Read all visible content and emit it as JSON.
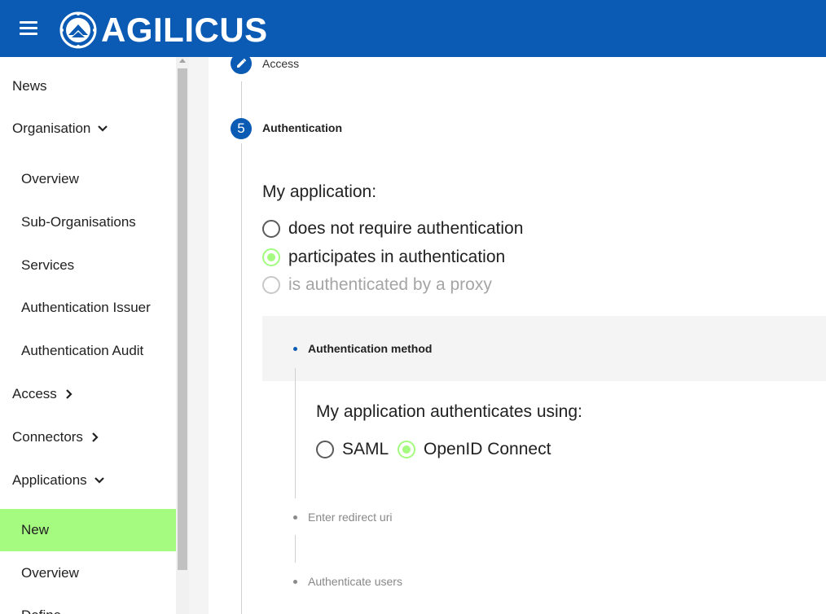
{
  "header": {
    "brand": "AGILICUS",
    "menu_icon": "hamburger-menu-icon",
    "brand_color": "#0b5bb5"
  },
  "sidebar": {
    "items": [
      {
        "label": "News"
      },
      {
        "label": "Organisation",
        "chevron": "chevron-down-icon"
      },
      {
        "label": "Overview"
      },
      {
        "label": "Sub-Organisations"
      },
      {
        "label": "Services"
      },
      {
        "label": "Authentication Issuer"
      },
      {
        "label": "Authentication Audit"
      },
      {
        "label": "Access",
        "chevron": "chevron-right-icon"
      },
      {
        "label": "Connectors",
        "chevron": "chevron-right-icon"
      },
      {
        "label": "Applications",
        "chevron": "chevron-down-icon"
      },
      {
        "label": "New",
        "active": true
      },
      {
        "label": "Overview"
      },
      {
        "label": "Define"
      }
    ],
    "active_color": "#a4fb7f"
  },
  "stepper": {
    "previous_step": {
      "label": "Access",
      "icon": "edit-pencil-icon"
    },
    "current_step": {
      "number": "5",
      "label": "Authentication"
    }
  },
  "auth_section": {
    "heading": "My application:",
    "options": [
      {
        "label": "does not require authentication",
        "state": "unchecked"
      },
      {
        "label": "participates in authentication",
        "state": "checked"
      },
      {
        "label": "is authenticated by a proxy",
        "state": "disabled"
      }
    ]
  },
  "substeps": {
    "method": {
      "label": "Authentication method",
      "heading": "My application authenticates using:",
      "options": [
        {
          "label": "SAML",
          "state": "unchecked"
        },
        {
          "label": "OpenID Connect",
          "state": "checked"
        }
      ]
    },
    "redirect": {
      "label": "Enter redirect uri"
    },
    "users": {
      "label": "Authenticate users"
    }
  }
}
